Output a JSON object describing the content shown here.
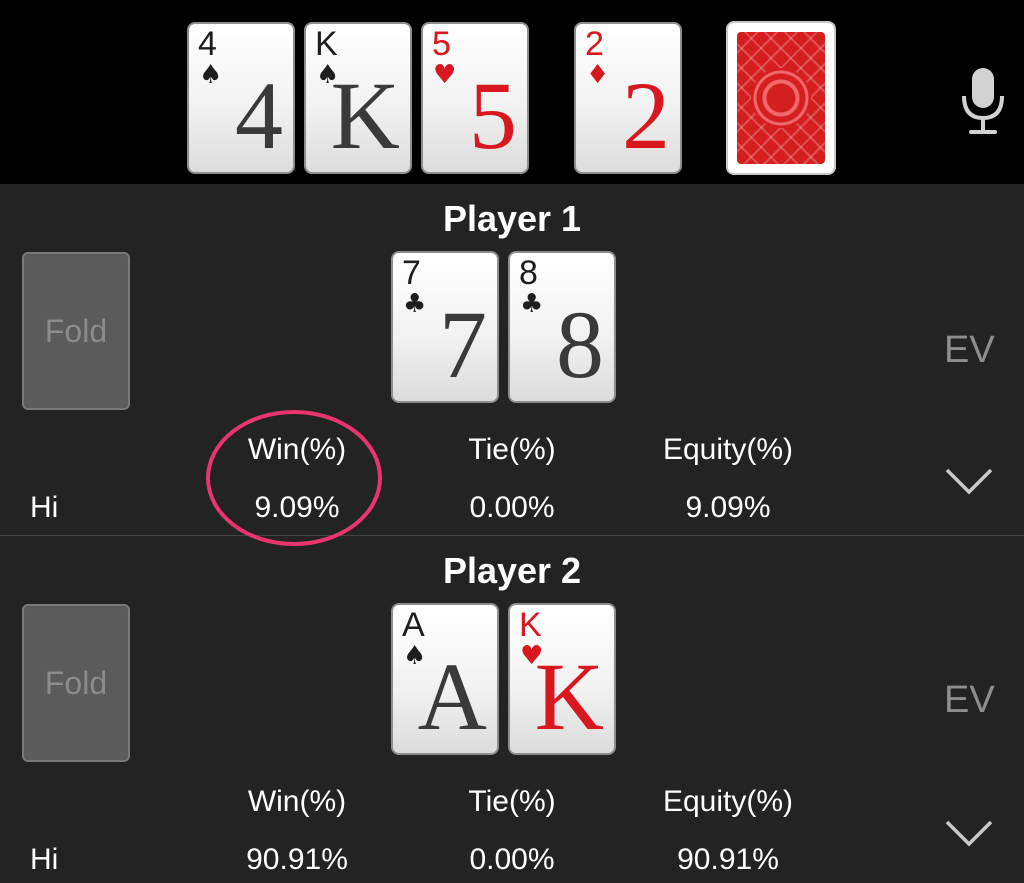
{
  "board": {
    "cards": [
      {
        "rank": "4",
        "suit": "♠",
        "color": "black"
      },
      {
        "rank": "K",
        "suit": "♠",
        "color": "black"
      },
      {
        "rank": "5",
        "suit": "♥",
        "color": "red"
      },
      {
        "rank": "2",
        "suit": "♦",
        "color": "red"
      }
    ],
    "card_back": "card-back"
  },
  "players": [
    {
      "title": "Player 1",
      "fold_label": "Fold",
      "ev_label": "EV",
      "cards": [
        {
          "rank": "7",
          "suit": "♣",
          "color": "black"
        },
        {
          "rank": "8",
          "suit": "♣",
          "color": "black"
        }
      ],
      "stats": {
        "headers": [
          "Win(%)",
          "Tie(%)",
          "Equity(%)"
        ],
        "row_label": "Hi",
        "values": [
          "9.09%",
          "0.00%",
          "9.09%"
        ]
      }
    },
    {
      "title": "Player 2",
      "fold_label": "Fold",
      "ev_label": "EV",
      "cards": [
        {
          "rank": "A",
          "suit": "♠",
          "color": "black"
        },
        {
          "rank": "K",
          "suit": "♥",
          "color": "red"
        }
      ],
      "stats": {
        "headers": [
          "Win(%)",
          "Tie(%)",
          "Equity(%)"
        ],
        "row_label": "Hi",
        "values": [
          "90.91%",
          "0.00%",
          "90.91%"
        ]
      }
    }
  ],
  "colors": {
    "background": "#232323",
    "board_background": "#000000",
    "red_suit": "#d8171f",
    "highlight": "#e8356e",
    "muted_text": "#8d8d8d"
  }
}
